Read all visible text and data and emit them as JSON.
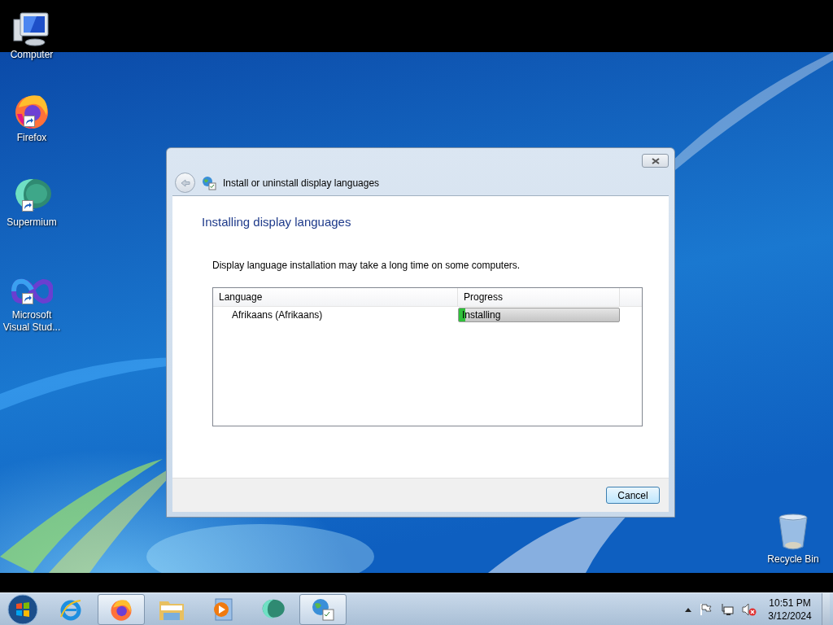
{
  "desktop_icons": [
    {
      "label": "Computer",
      "shortcut": false
    },
    {
      "label": "Firefox",
      "shortcut": true
    },
    {
      "label": "Supermium",
      "shortcut": true
    },
    {
      "label": "Microsoft Visual Stud...",
      "shortcut": true
    },
    {
      "label": "Recycle Bin",
      "shortcut": false
    }
  ],
  "dialog": {
    "nav_title": "Install or uninstall display languages",
    "heading": "Installing display languages",
    "description": "Display language installation may take a long time on some computers.",
    "table": {
      "columns": [
        "Language",
        "Progress"
      ],
      "rows": [
        {
          "language": "Afrikaans (Afrikaans)",
          "progress": {
            "label": "Installing",
            "level": 0.04
          }
        }
      ]
    },
    "buttons": [
      "Cancel"
    ]
  },
  "taskbar": {
    "items": [
      {
        "running": false
      },
      {
        "running": true
      },
      {
        "running": false
      },
      {
        "running": false
      },
      {
        "running": false
      },
      {
        "running": true
      }
    ],
    "clock": {
      "time": "10:51 PM",
      "date": "3/12/2024"
    }
  }
}
